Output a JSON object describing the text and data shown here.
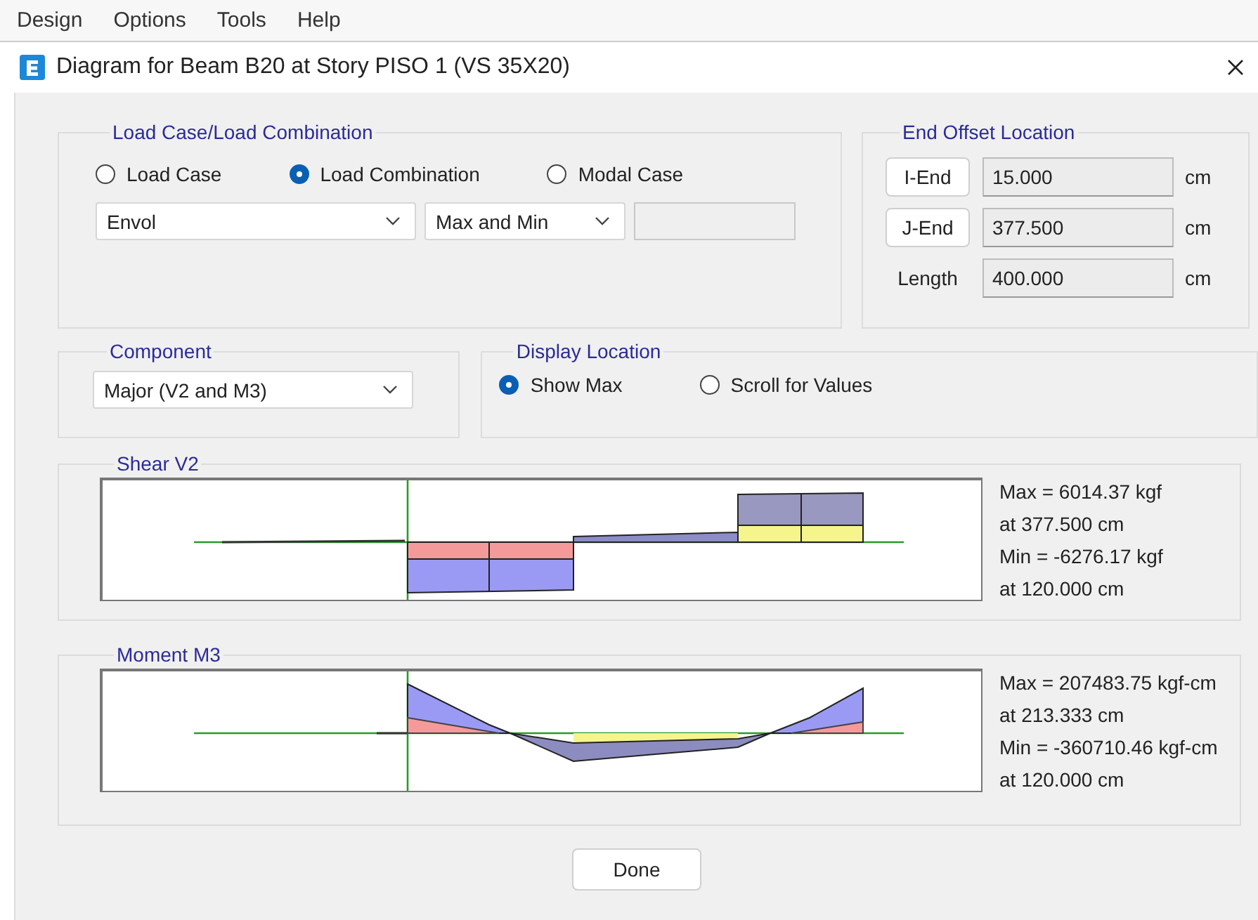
{
  "menu": [
    "Design",
    "Options",
    "Tools",
    "Help"
  ],
  "window": {
    "title": "Diagram for Beam B20 at Story PISO 1 (VS 35X20)"
  },
  "load_case": {
    "title": "Load Case/Load Combination",
    "options": [
      {
        "label": "Load Case",
        "selected": false
      },
      {
        "label": "Load Combination",
        "selected": true
      },
      {
        "label": "Modal Case",
        "selected": false
      }
    ],
    "case_select": "Envol",
    "type_select": "Max and Min"
  },
  "end_offset": {
    "title": "End Offset Location",
    "rows": [
      {
        "kind": "button",
        "label": "I-End",
        "value": "15.000",
        "unit": "cm"
      },
      {
        "kind": "button",
        "label": "J-End",
        "value": "377.500",
        "unit": "cm"
      },
      {
        "kind": "label",
        "label": "Length",
        "value": "400.000",
        "unit": "cm"
      }
    ]
  },
  "component": {
    "title": "Component",
    "value": "Major (V2 and M3)"
  },
  "display_location": {
    "title": "Display Location",
    "options": [
      {
        "label": "Show Max",
        "selected": true
      },
      {
        "label": "Scroll for Values",
        "selected": false
      }
    ]
  },
  "diagrams": [
    {
      "kind": "shear",
      "title": "Shear V2",
      "lines": [
        "Max = 6014.37 kgf",
        "at 377.500 cm",
        "Min = -6276.17 kgf",
        "at 120.000 cm"
      ]
    },
    {
      "kind": "moment",
      "title": "Moment M3",
      "lines": [
        "Max = 207483.75 kgf-cm",
        "at 213.333 cm",
        "Min = -360710.46 kgf-cm",
        "at 120.000 cm"
      ]
    }
  ],
  "buttons": [
    "Done"
  ]
}
